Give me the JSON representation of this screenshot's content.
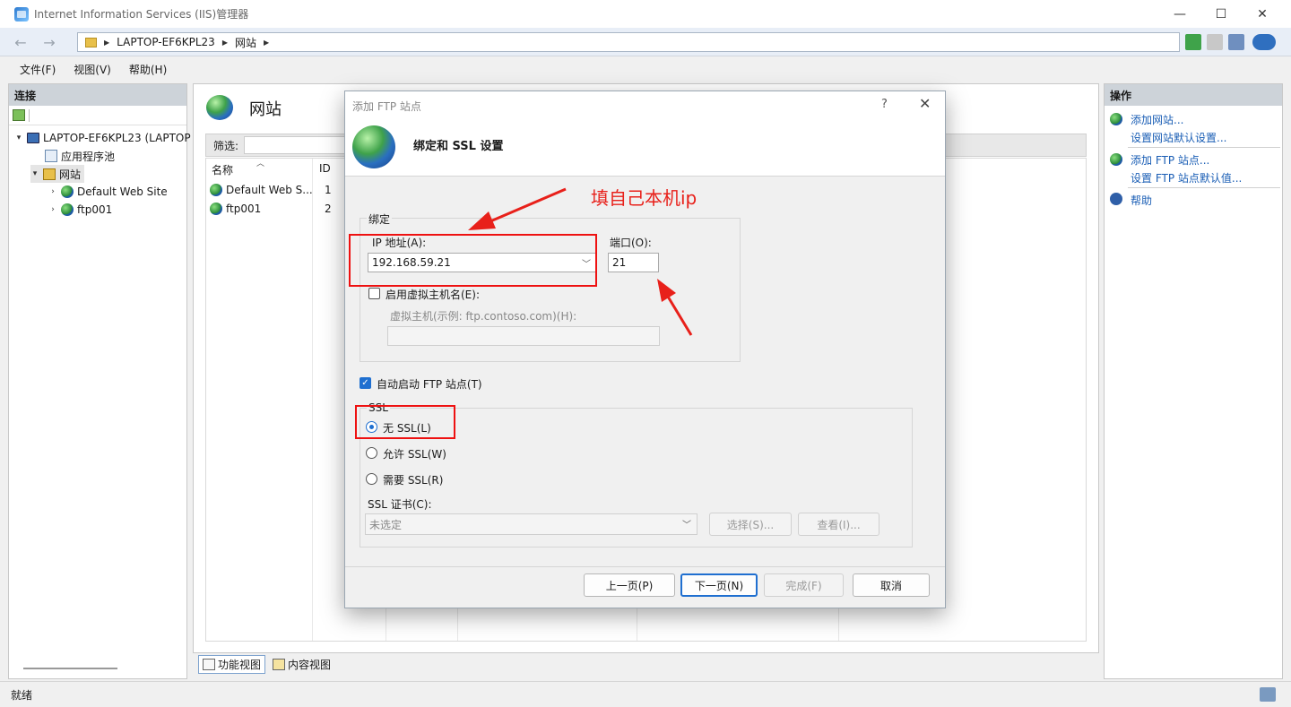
{
  "window": {
    "title": "Internet Information Services (IIS)管理器"
  },
  "address": {
    "host": "LAPTOP-EF6KPL23",
    "node": "网站"
  },
  "menu": [
    "文件(F)",
    "视图(V)",
    "帮助(H)"
  ],
  "connections": {
    "header": "连接",
    "tree": {
      "server": "LAPTOP-EF6KPL23 (LAPTOP",
      "app_pool": "应用程序池",
      "sites": "网站",
      "site1": "Default Web Site",
      "site2": "ftp001"
    }
  },
  "center": {
    "title": "网站",
    "filter_label": "筛选:",
    "columns": [
      "名称",
      "ID"
    ],
    "rows": [
      {
        "name": "Default Web S...",
        "id": "1"
      },
      {
        "name": "ftp001",
        "id": "2"
      }
    ],
    "tabs": [
      "功能视图",
      "内容视图"
    ]
  },
  "actions": {
    "header": "操作",
    "items": [
      "添加网站...",
      "设置网站默认设置...",
      "添加 FTP 站点...",
      "设置 FTP 站点默认值...",
      "帮助"
    ]
  },
  "status": "就绪",
  "dialog": {
    "title": "添加 FTP 站点",
    "help_glyph": "?",
    "heading": "绑定和 SSL 设置",
    "binding_group": "绑定",
    "ip_label": "IP 地址(A):",
    "ip_value": "192.168.59.21",
    "port_label": "端口(O):",
    "port_value": "21",
    "vhost_check_label": "启用虚拟主机名(E):",
    "vhost_label": "虚拟主机(示例: ftp.contoso.com)(H):",
    "vhost_value": "",
    "autostart_label": "自动启动 FTP 站点(T)",
    "ssl_group": "SSL",
    "ssl_options": [
      "无 SSL(L)",
      "允许 SSL(W)",
      "需要 SSL(R)"
    ],
    "cert_label": "SSL 证书(C):",
    "cert_value": "未选定",
    "select_btn": "选择(S)...",
    "view_btn": "查看(I)...",
    "buttons": {
      "prev": "上一页(P)",
      "next": "下一页(N)",
      "finish": "完成(F)",
      "cancel": "取消"
    }
  },
  "annotation": {
    "text": "填自己本机ip",
    "color": "#e8201a"
  }
}
